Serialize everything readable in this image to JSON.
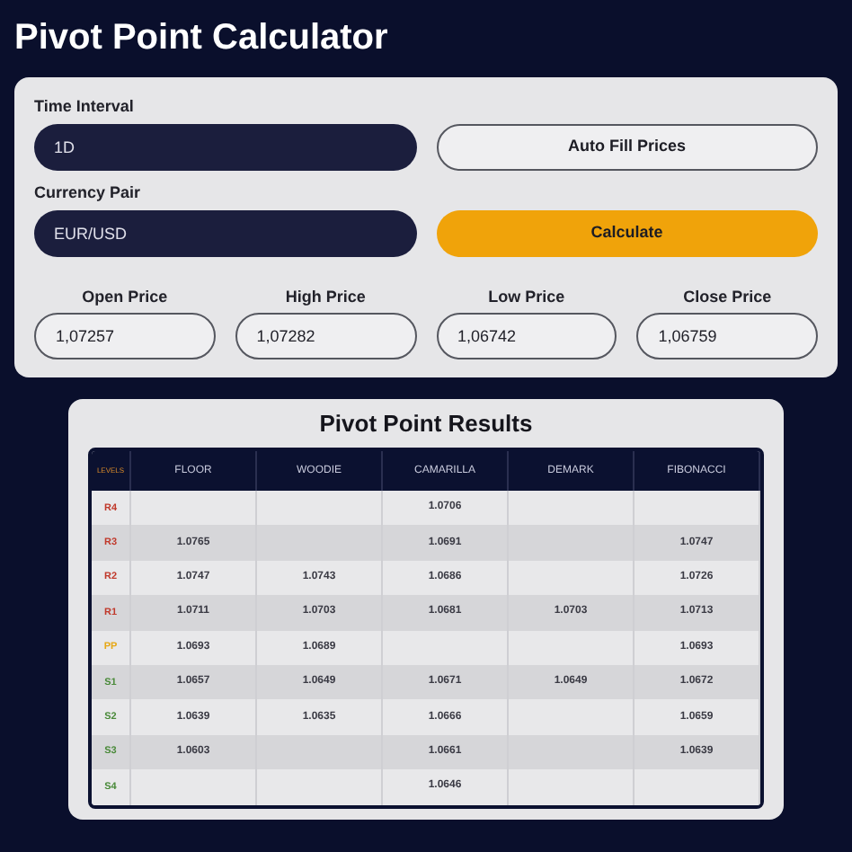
{
  "title": "Pivot Point Calculator",
  "form": {
    "time_interval": {
      "label": "Time Interval",
      "value": "1D"
    },
    "currency_pair": {
      "label": "Currency Pair",
      "value": "EUR/USD"
    },
    "buttons": [
      {
        "label": "Auto Fill Prices",
        "kind": "outline"
      },
      {
        "label": "Calculate",
        "kind": "primary"
      }
    ],
    "prices": [
      {
        "label": "Open Price",
        "value": "1,07257"
      },
      {
        "label": "High Price",
        "value": "1,07282"
      },
      {
        "label": "Low Price",
        "value": "1,06742"
      },
      {
        "label": "Close Price",
        "value": "1,06759"
      }
    ]
  },
  "results": {
    "title": "Pivot Point Results",
    "columns": [
      "LEVELS",
      "FLOOR",
      "WOODIE",
      "CAMARILLA",
      "DEMARK",
      "FIBONACCI"
    ],
    "rows": [
      {
        "color": "#c0392b",
        "cells": [
          "R4",
          "",
          "",
          "1.0706",
          "",
          ""
        ]
      },
      {
        "color": "#c0392b",
        "cells": [
          "R3",
          "1.0765",
          "",
          "1.0691",
          "",
          "1.0747"
        ]
      },
      {
        "color": "#c0392b",
        "cells": [
          "R2",
          "1.0747",
          "1.0743",
          "1.0686",
          "",
          "1.0726"
        ]
      },
      {
        "color": "#c0392b",
        "cells": [
          "R1",
          "1.0711",
          "1.0703",
          "1.0681",
          "1.0703",
          "1.0713"
        ]
      },
      {
        "color": "#e6a817",
        "cells": [
          "PP",
          "1.0693",
          "1.0689",
          "",
          "",
          "1.0693"
        ]
      },
      {
        "color": "#4a8a3a",
        "cells": [
          "S1",
          "1.0657",
          "1.0649",
          "1.0671",
          "1.0649",
          "1.0672"
        ]
      },
      {
        "color": "#4a8a3a",
        "cells": [
          "S2",
          "1.0639",
          "1.0635",
          "1.0666",
          "",
          "1.0659"
        ]
      },
      {
        "color": "#4a8a3a",
        "cells": [
          "S3",
          "1.0603",
          "",
          "1.0661",
          "",
          "1.0639"
        ]
      },
      {
        "color": "#4a8a3a",
        "cells": [
          "S4",
          "",
          "",
          "1.0646",
          "",
          ""
        ]
      }
    ]
  }
}
